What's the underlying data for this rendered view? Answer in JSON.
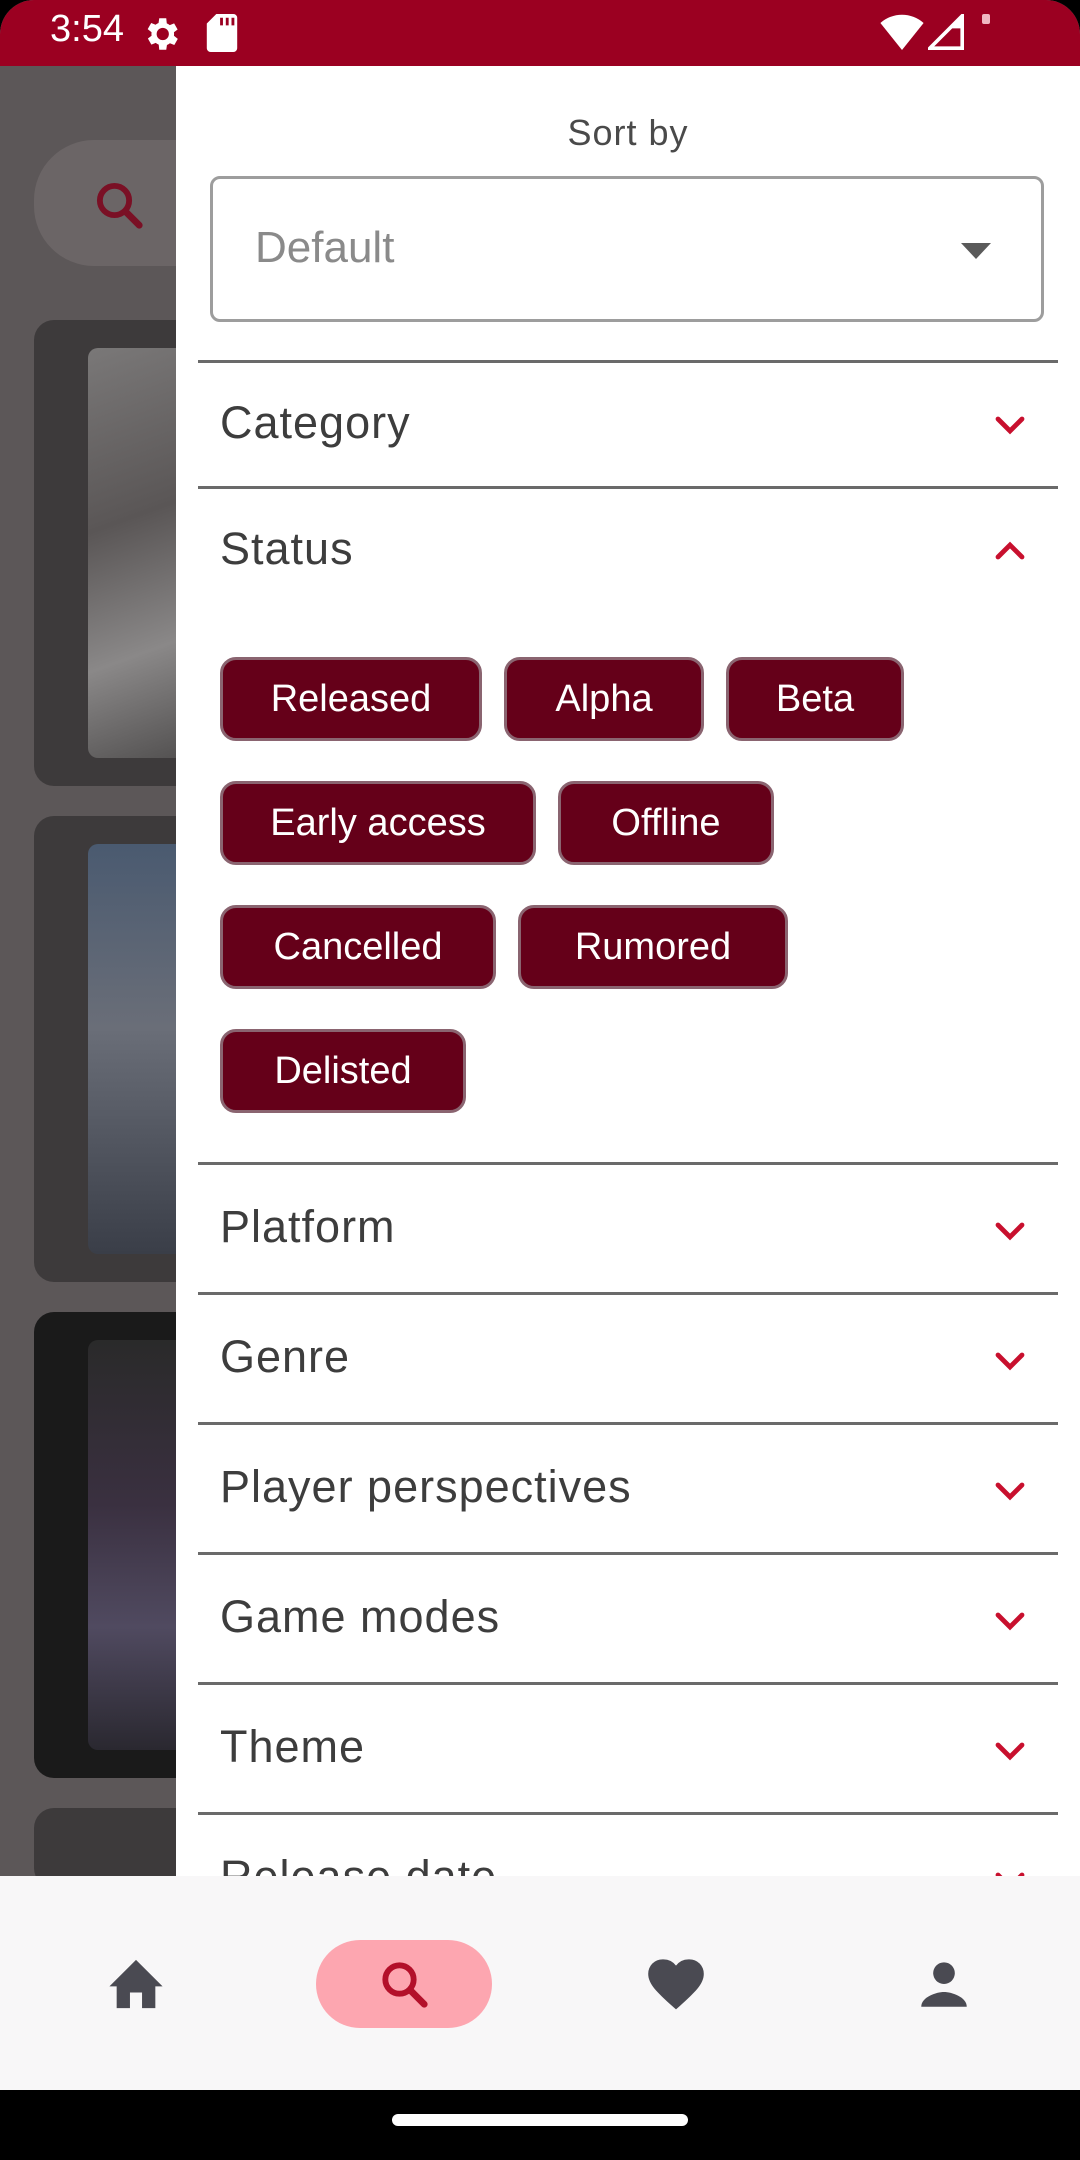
{
  "status_bar": {
    "time": "3:54",
    "icons": [
      "settings-gear-icon",
      "sd-card-icon",
      "wifi-icon",
      "signal-icon",
      "battery-dot-icon"
    ],
    "background_color": "#9b0021"
  },
  "drawer": {
    "sort": {
      "label": "Sort by",
      "selected_value": "Default"
    },
    "sections": [
      {
        "key": "category",
        "title": "Category",
        "expanded": false
      },
      {
        "key": "status",
        "title": "Status",
        "expanded": true
      },
      {
        "key": "platform",
        "title": "Platform",
        "expanded": false
      },
      {
        "key": "genre",
        "title": "Genre",
        "expanded": false
      },
      {
        "key": "player_perspectives",
        "title": "Player perspectives",
        "expanded": false
      },
      {
        "key": "game_modes",
        "title": "Game modes",
        "expanded": false
      },
      {
        "key": "theme",
        "title": "Theme",
        "expanded": false
      },
      {
        "key": "release_date",
        "title": "Release date",
        "expanded": false
      }
    ],
    "status_chips": [
      "Released",
      "Alpha",
      "Beta",
      "Early access",
      "Offline",
      "Cancelled",
      "Rumored",
      "Delisted"
    ],
    "accent_color": "#c8102e",
    "chip_color": "#650019"
  },
  "bottom_nav": {
    "items": [
      {
        "name": "home",
        "icon": "home-icon",
        "active": false
      },
      {
        "name": "search",
        "icon": "search-icon",
        "active": true
      },
      {
        "name": "favorites",
        "icon": "heart-icon",
        "active": false
      },
      {
        "name": "profile",
        "icon": "person-icon",
        "active": false
      }
    ],
    "active_indicator_color": "#fda6b0"
  }
}
